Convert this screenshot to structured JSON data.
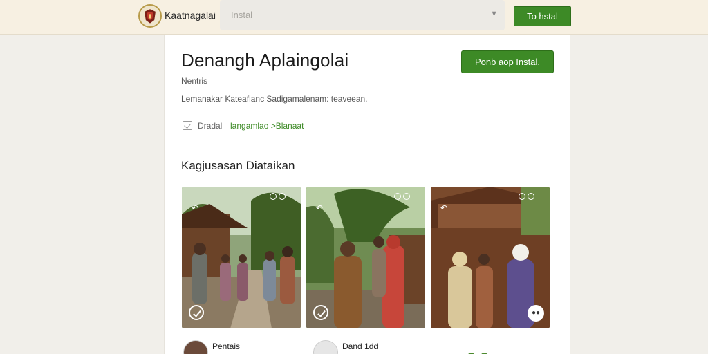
{
  "header": {
    "brand": "Kaatnagalai",
    "search_placeholder": "Instal",
    "install_label": "To hstal"
  },
  "app": {
    "title": "Denangh Aplaingolai",
    "developer": "Nentris",
    "tagline": "Lemanakar Kateafianc Sadigamalenam: teaveean.",
    "install_label": "Ponb aop Instal.",
    "info_text": "Dradal",
    "info_link": "langamlao >Blanaat"
  },
  "screenshots": {
    "title": "Kagjusasan Diataikan",
    "items": [
      {
        "caption": "Village path with group of villagers"
      },
      {
        "caption": "Villagers talking under palm trees"
      },
      {
        "caption": "Women greeting at wooden house"
      }
    ]
  },
  "reviews": [
    {
      "name": "Pentais"
    },
    {
      "name": "Dand 1dd"
    }
  ],
  "colors": {
    "accent": "#3d8a26",
    "header_bg": "#f7f0e2",
    "page_bg": "#f1efea"
  }
}
